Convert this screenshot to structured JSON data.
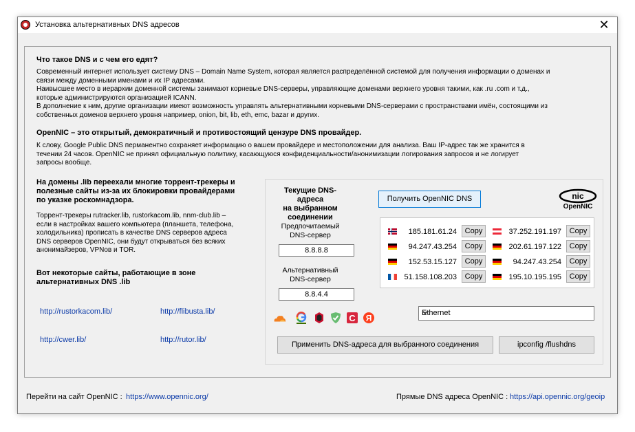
{
  "window": {
    "title": "Установка альтернативных DNS адресов",
    "close": "✕"
  },
  "intro": {
    "heading": "Что такое DNS и с чем его едят?",
    "p1": "Современный интернет использует систему DNS – Domain Name System, которая является распределённой системой для получения информации о доменах и",
    "p1b": "связи между доменными именами и их IP адресами.",
    "p2": "Наивысшее место в иерархии доменной системы занимают корневые DNS-серверы, управляющие доменами верхнего уровня такими, как .ru .com и т.д.,",
    "p2b": "которые администрируются организацией ICANN.",
    "p3": "В дополнение к ним, другие организации имеют возможность управлять альтернативными корневыми DNS-серверами с пространствами имён, состоящими из",
    "p3b": "собственных доменов верхнего уровня например, onion, bit, lib, eth, emc, bazar и других."
  },
  "opennic": {
    "heading": "OpenNIC – это открытый, демократичный и противостоящий цензуре DNS провайдер.",
    "p1": "К слову, Google Public DNS перманентно сохраняет информацию о вашем провайдере и местоположении для анализа. Ваш IP-адрес так же хранится в",
    "p1b": "течении 24 часов. OpenNIC не принял официальную политику, касающуюся конфиденциальности/анонимизации логирования запросов и не логирует",
    "p1c": "запросы вообще."
  },
  "lib": {
    "heading1": "На домены .lib переехали многие торрент-трекеры и",
    "heading2": "полезные сайты из-за их блокировки провайдерами",
    "heading3": "по указке роскомнадзора.",
    "t1": "Торрент-трекеры rutracker.lib, rustorkacom.lib, nnm-club.lib –",
    "t2": "если в настройках вашего компьютера (планшета, телефона,",
    "t3": "холодильника) прописать в качестве DNS серверов адреса",
    "t4": "DNS серверов OpenNIC, они будут открываться без всяких",
    "t5": "анонимайзеров, VPNов и TOR.",
    "sites_heading1": "Вот некоторые сайты, работающие в зоне",
    "sites_heading2": "альтернативных DNS .lib",
    "links": [
      "http://rustorkacom.lib/",
      "http://flibusta.lib/",
      "http://cwer.lib/",
      "http://rutor.lib/"
    ]
  },
  "current": {
    "heading1": "Текущие DNS-адреса",
    "heading2": "на выбранном",
    "heading3": "соединении",
    "pref_label1": "Предпочитаемый",
    "pref_label2": "DNS-сервер",
    "pref_value": "8.8.8.8",
    "alt_label1": "Альтернативный",
    "alt_label2": "DNS-сервер",
    "alt_value": "8.8.4.4"
  },
  "get_button": "Получить OpenNIC DNS",
  "logo": {
    "top": "nic",
    "bottom": "OpenNIC"
  },
  "servers": [
    {
      "ip": "185.181.61.24",
      "flag": "norway",
      "copy": "Copy"
    },
    {
      "ip": "94.247.43.254",
      "flag": "germany",
      "copy": "Copy"
    },
    {
      "ip": "152.53.15.127",
      "flag": "germany",
      "copy": "Copy"
    },
    {
      "ip": "51.158.108.203",
      "flag": "france",
      "copy": "Copy"
    },
    {
      "ip": "37.252.191.197",
      "flag": "austria",
      "copy": "Copy"
    },
    {
      "ip": "202.61.197.122",
      "flag": "germany",
      "copy": "Copy"
    },
    {
      "ip": "94.247.43.254",
      "flag": "germany",
      "copy": "Copy"
    },
    {
      "ip": "195.10.195.195",
      "flag": "germany",
      "copy": "Copy"
    }
  ],
  "provider_icons": [
    "cloudflare-icon",
    "google-icon",
    "quad9-icon",
    "adguard-icon",
    "comss-icon",
    "yandex-icon"
  ],
  "connection": {
    "selected": "Ethernet"
  },
  "apply_button": "Применить DNS-адреса для выбранного соединения",
  "flush_button": "ipconfig /flushdns",
  "footer": {
    "left_label": "Перейти на сайт OpenNIC :",
    "left_link": "https://www.opennic.org/",
    "right_label": "Прямые DNS адреса OpenNIC :",
    "right_link": "https://api.opennic.org/geoip"
  },
  "colors": {
    "link": "#0b3aa8",
    "accent": "#0078d7",
    "title_icon": "#c62828"
  }
}
